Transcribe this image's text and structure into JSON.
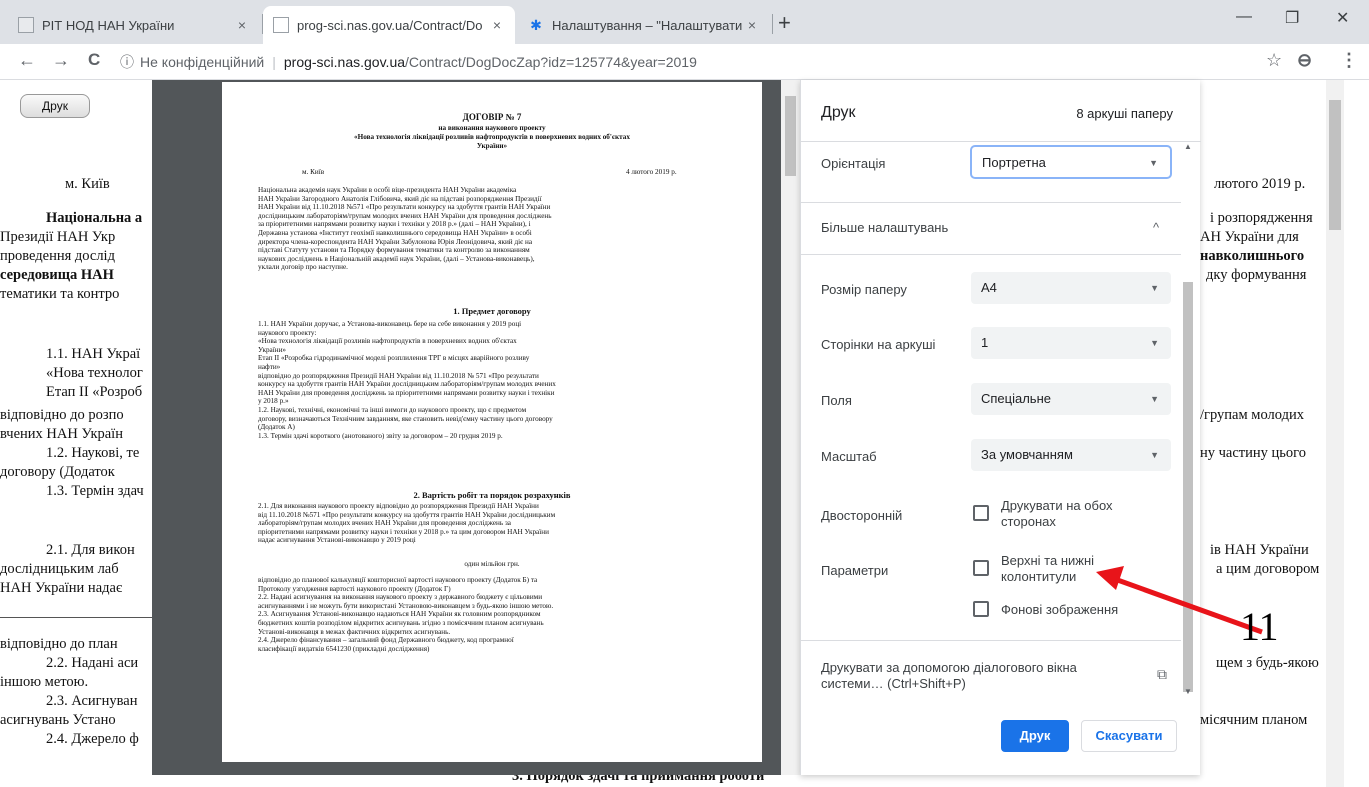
{
  "tabs": [
    {
      "title": "РІТ НОД НАН України",
      "close": "×"
    },
    {
      "title": "prog-sci.nas.gov.ua/Contract/Do",
      "close": "×"
    },
    {
      "title": "Налаштування – \"Налаштувати",
      "close": "×"
    }
  ],
  "new_tab": "+",
  "window_controls": {
    "minimize": "—",
    "maximize": "❐",
    "close": "✕"
  },
  "toolbar": {
    "back": "←",
    "forward": "→",
    "reload": "C",
    "info": "ⓘ",
    "security": "Не конфіденційний",
    "host": "prog-sci.nas.gov.ua",
    "path": "/Contract/DogDocZap?idz=125774&year=2019",
    "star": "☆",
    "profile": "⊖",
    "menu": "⋮"
  },
  "page": {
    "print_button": "Друк",
    "lines": [
      "м. Київ",
      "лютого 2019 р.",
      "Національна а",
      "і розпорядження",
      "Президії НАН Укр",
      "АН України для",
      "проведення дослід",
      "навколишнього",
      "середовища НАН",
      "дку формування",
      "тематики та контро",
      "1.1. НАН Украї",
      "«Нова технолог",
      "Етап II «Розроб",
      "відповідно до розпо",
      "/групам молодих",
      "вчених НАН Україн",
      "1.2. Наукові, те",
      "ну частину цього",
      "договору (Додаток",
      "1.3. Термін здач",
      "2.1. Для викон",
      "ів НАН України",
      "дослідницьким лаб",
      "а цим договором",
      "НАН України надає",
      "відповідно до план",
      "2.2. Надані аси",
      "щем з будь-якою",
      "іншою метою.",
      "2.3. Асигнуван",
      "місячним планом",
      "асигнувань Устано",
      "2.4. Джерело ф",
      "3. Порядок здачі та приймання роботи"
    ]
  },
  "preview_sheet": {
    "title": "ДОГОВІР № 7",
    "subtitle1": "на виконання наукового проекту",
    "subtitle2": "«Нова технологія ліквідації розливів нафтопродуктів в поверхневих водних об'єктах",
    "subtitle3": "України»",
    "city": "м. Київ",
    "date": "4 лютого 2019 р.",
    "intro": [
      "Національна академія наук України в особі віце-президента НАН України академіка",
      "НАН України Загородного Анатолія Глібовича, який діє на підставі розпорядження Президії",
      "НАН України від 11.10.2018 №571 «Про результати конкурсу на здобуття грантів НАН України",
      "дослідницьким лабораторіям/групам молодих вчених НАН України для проведення досліджень",
      "за пріоритетними напрямами розвитку науки і техніки у 2018 р.» (далі – НАН України), і",
      "Державна установа «Інститут геохімії навколишнього середовища НАН України» в особі",
      "директора члена-кореспондента НАН України Забулонова Юрія Леонідовича, який діє на",
      "підставі Статуту установи та Порядку формування тематики та контролю за виконанням",
      "наукових досліджень в Національній академії наук України, (далі – Установа-виконавець),",
      "уклали договір про наступне."
    ],
    "s1_title": "1. Предмет договору",
    "s1": [
      "1.1. НАН України доручає, а Установа-виконавець бере на себе виконання у 2019 році",
      "наукового проекту:",
      "«Нова технологія ліквідації розливів нафтопродуктів в поверхневих водних об'єктах",
      "України»",
      "Етап II «Розробка гідродинамічної моделі розплилення ТРГ в місцях аварійного розливу",
      "нафти»",
      "відповідно до розпорядження Президії НАН України від 11.10.2018 № 571 «Про результати",
      "конкурсу на здобуття грантів НАН України дослідницьким лабораторіям/групам молодих вчених",
      "НАН України для проведення досліджень за пріоритетними напрямами розвитку науки і техніки",
      "у 2018 р.»",
      "1.2. Наукові, технічні, економічні та інші вимоги до наукового проекту, що є предметом",
      "договору, визначаються Технічним завданням, яке становить невід'ємну частину цього договору",
      "(Додаток А)",
      "1.3. Термін здачі короткого (анотованого) звіту за договором – 20 грудня 2019 р."
    ],
    "s2_title": "2. Вартість робіт та порядок розрахунків",
    "s2": [
      "2.1. Для виконання наукового проекту відповідно до розпорядження Президії НАН України",
      "від 11.10.2018 №571 «Про результати конкурсу на здобуття грантів НАН України дослідницьким",
      "лабораторіям/групам молодих вчених НАН України для проведення досліджень за",
      "пріоритетними напрямами розвитку науки і техніки у 2018 р.» та цим договором НАН України",
      "надає асигнування Установі-виконавцю у 2019 році"
    ],
    "amount": "один мільйон грн.",
    "s2b": [
      "відповідно до планової калькуляції кошторисної вартості наукового проекту (Додаток Б) та",
      "Протоколу узгодження вартості наукового проекту (Додаток Г)",
      "2.2. Надані асигнування на виконання наукового проекту з державного бюджету є цільовими",
      "асигнуваннями і не можуть бути використані Установою-виконавцем з будь-якою іншою метою.",
      "2.3. Асигнування Установі-виконавцю надаються НАН України як головним розпорядником",
      "бюджетних коштів розподілом відкритих асигнувань згідно з помісячним планом асигнувань",
      "Установі-виконавця в межах фактичних відкритих асигнувань.",
      "2.4. Джерело фінансування – загальний фонд Державного бюджету, код програмної",
      "класифікації видатків 6541230 (прикладні дослідження)"
    ]
  },
  "print_dialog": {
    "title": "Друк",
    "sheet_count": "8 аркуші паперу",
    "orientation_label": "Орієнтація",
    "orientation_value": "Портретна",
    "more_settings": "Більше налаштувань",
    "more_toggle": "^",
    "paper_size_label": "Розмір паперу",
    "paper_size_value": "A4",
    "pages_per_sheet_label": "Сторінки на аркуші",
    "pages_per_sheet_value": "1",
    "margins_label": "Поля",
    "margins_value": "Спеціальне",
    "scale_label": "Масштаб",
    "scale_value": "За умовчанням",
    "duplex_label": "Двосторонній",
    "duplex_line1": "Друкувати на обох",
    "duplex_line2": "сторонах",
    "options_label": "Параметри",
    "headers_line1": "Верхні та нижні",
    "headers_line2": "колонтитули",
    "backgrounds": "Фонові зображення",
    "system_dialog_line1": "Друкувати за допомогою діалогового вікна",
    "system_dialog_line2": "системи… (Ctrl+Shift+P)",
    "open_icon": "⧉",
    "print_button": "Друк",
    "cancel_button": "Скасувати",
    "dropdown_arrow": "▼"
  },
  "annotation": {
    "number": "11",
    "color": "#e8141a"
  }
}
